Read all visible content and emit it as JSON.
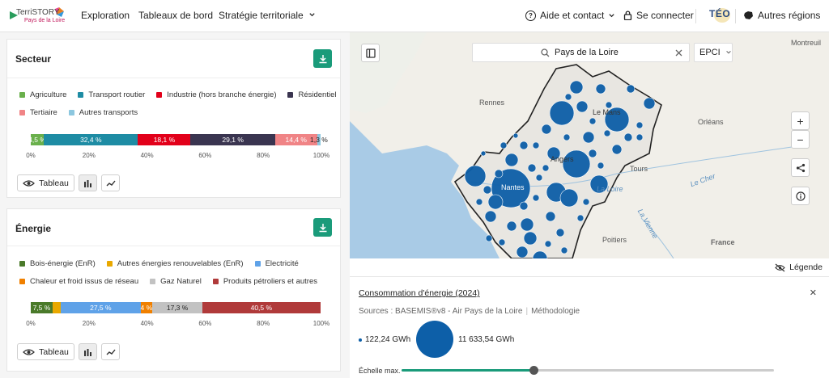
{
  "header": {
    "logo_name": "TerriSTORY",
    "logo_region": "Pays de la Loire",
    "nav": [
      "Exploration",
      "Tableaux de bord",
      "Stratégie territoriale"
    ],
    "help": "Aide et contact",
    "login": "Se connecter",
    "teo": "TÉO",
    "regions": "Autres régions"
  },
  "secteur": {
    "title": "Secteur",
    "legend": [
      {
        "label": "Agriculture",
        "color": "#6ab04c"
      },
      {
        "label": "Transport routier",
        "color": "#1e8ca4"
      },
      {
        "label": "Industrie (hors branche énergie)",
        "color": "#e2001a"
      },
      {
        "label": "Résidentiel",
        "color": "#3a3550"
      },
      {
        "label": "Tertiaire",
        "color": "#f08486"
      },
      {
        "label": "Autres transports",
        "color": "#8cc7df"
      }
    ],
    "segments": [
      {
        "label": "4,5 %",
        "pct": 4.5,
        "color": "#6ab04c"
      },
      {
        "label": "32,4 %",
        "pct": 32.4,
        "color": "#1e8ca4"
      },
      {
        "label": "18,1 %",
        "pct": 18.1,
        "color": "#e2001a"
      },
      {
        "label": "29,1 %",
        "pct": 29.1,
        "color": "#3a3550"
      },
      {
        "label": "14,4 %",
        "pct": 14.4,
        "color": "#f08486"
      },
      {
        "label": "1,3 %",
        "pct": 1.3,
        "color": "#8cc7df"
      }
    ]
  },
  "energie": {
    "title": "Énergie",
    "legend": [
      {
        "label": "Bois-énergie (EnR)",
        "color": "#4a7a2a"
      },
      {
        "label": "Autres énergies renouvelables (EnR)",
        "color": "#e9a800"
      },
      {
        "label": "Electricité",
        "color": "#5fa2e8"
      },
      {
        "label": "Chaleur et froid issus de réseau",
        "color": "#f08000"
      },
      {
        "label": "Gaz Naturel",
        "color": "#c2c2c2"
      },
      {
        "label": "Produits pétroliers et autres",
        "color": "#b03a3a"
      }
    ],
    "segments": [
      {
        "label": "7,5 %",
        "pct": 7.5,
        "color": "#4a7a2a"
      },
      {
        "label": "",
        "pct": 2.8,
        "color": "#e9a800"
      },
      {
        "label": "27,5 %",
        "pct": 27.5,
        "color": "#5fa2e8"
      },
      {
        "label": "4 %",
        "pct": 4.0,
        "color": "#f08000"
      },
      {
        "label": "17,3 %",
        "pct": 17.3,
        "color": "#c2c2c2"
      },
      {
        "label": "40,5 %",
        "pct": 40.5,
        "color": "#b03a3a"
      }
    ]
  },
  "ticks": [
    "0%",
    "20%",
    "40%",
    "60%",
    "80%",
    "100%"
  ],
  "table_btn": "Tableau",
  "map": {
    "search_value": "Pays de la Loire",
    "level": "EPCI",
    "labels": [
      "Montreuil",
      "Rennes",
      "Orléans",
      "Tours",
      "Poitiers",
      "France",
      "Le Mans",
      "Angers",
      "Nantes",
      "La Loire",
      "La Vienne",
      "Le Cher"
    ]
  },
  "panel": {
    "legende": "Légende",
    "title": "Consommation d'énergie (2024)",
    "source": "Sources : BASEMIS®v8 - Air Pays de la Loire",
    "methodo": "Méthodologie",
    "min": "122,24 GWh",
    "max": "11 633,54 GWh",
    "echelle": "Échelle max.",
    "slider_value": 0.355
  }
}
